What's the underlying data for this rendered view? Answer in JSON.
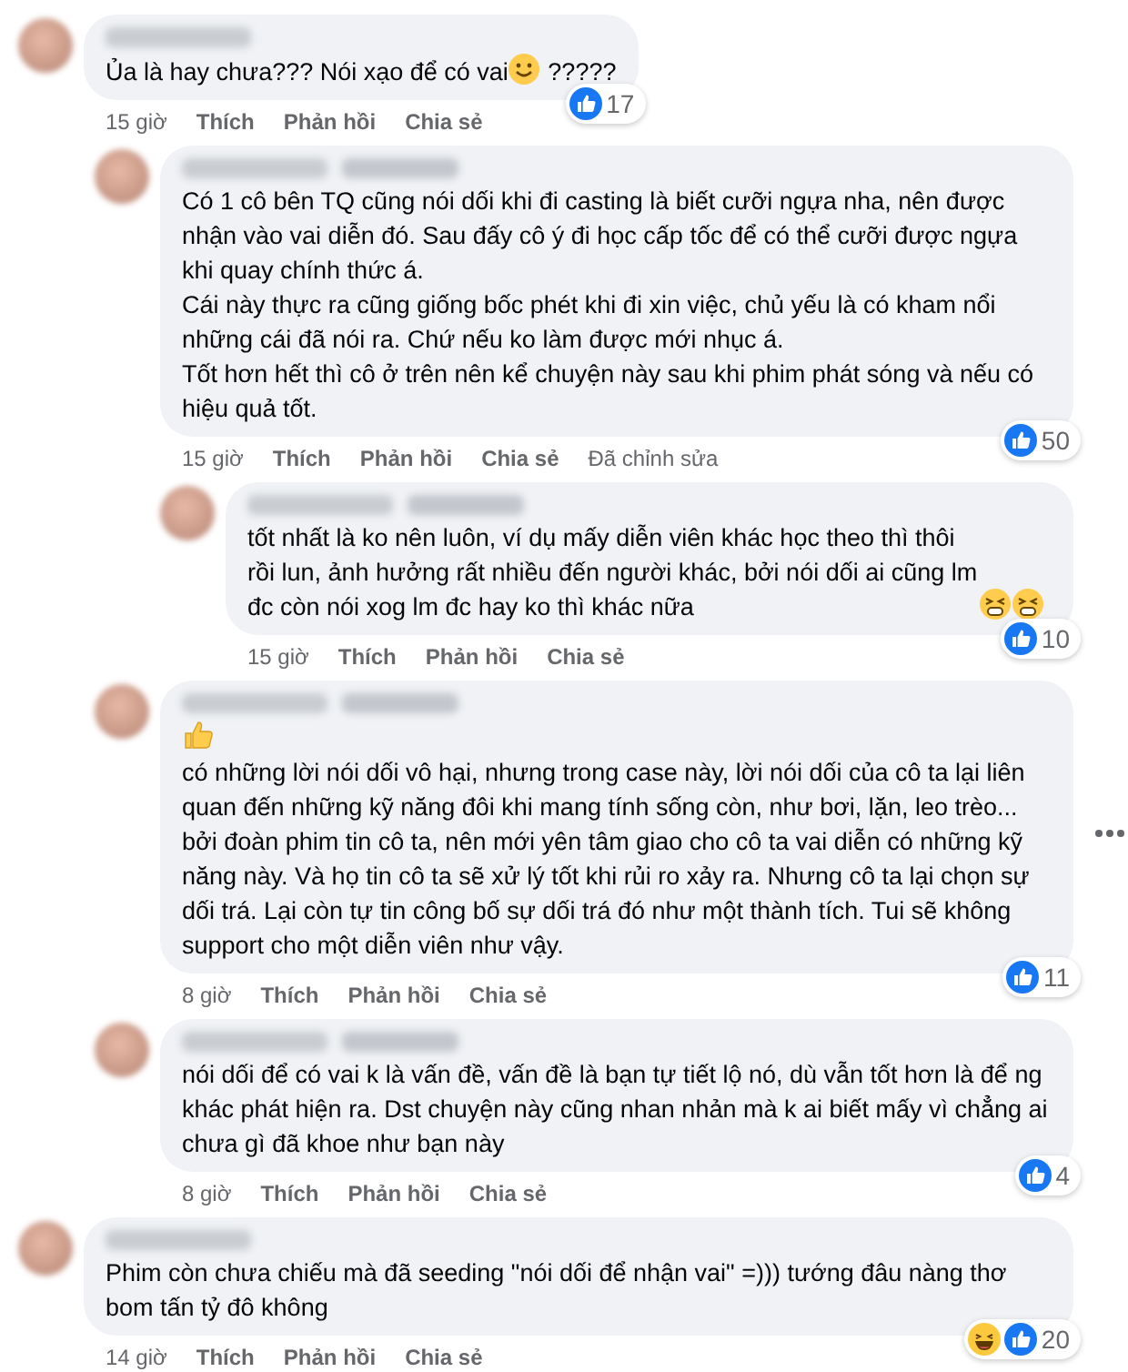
{
  "comments": [
    {
      "body": [
        {
          "kind": "text",
          "text": "Ủa là hay chưa??? Nói xạo để có vai "
        },
        {
          "kind": "smile"
        },
        {
          "kind": "text",
          "text": " ?????"
        }
      ],
      "reactions": [
        {
          "kind": "like"
        }
      ],
      "reaction_count": "17",
      "time": "15 giờ",
      "actions": [
        "Thích",
        "Phản hồi",
        "Chia sẻ"
      ],
      "children": [
        {
          "body": [
            {
              "kind": "mention"
            },
            {
              "kind": "text",
              "text": "Có 1 cô bên TQ cũng nói dối khi đi casting là biết cưỡi ngựa nha, nên được nhận vào vai diễn đó. Sau đấy cô ý đi học cấp tốc để có thể cưỡi được ngựa khi quay chính thức á.\nCái này thực ra cũng giống bốc phét khi đi xin việc, chủ yếu là có kham nổi những cái đã nói ra. Chứ nếu ko làm được mới nhục á.\nTốt hơn hết thì cô ở trên nên kể chuyện này sau khi phim phát sóng và nếu có hiệu quả tốt."
            }
          ],
          "reactions": [
            {
              "kind": "like"
            }
          ],
          "reaction_count": "50",
          "time": "15 giờ",
          "actions": [
            "Thích",
            "Phản hồi",
            "Chia sẻ"
          ],
          "edited": "Đã chỉnh sửa",
          "children": [
            {
              "body": [
                {
                  "kind": "mention"
                },
                {
                  "kind": "text",
                  "text": "tốt nhất là ko nên luôn, ví dụ mấy diễn viên khác học theo thì thôi rồi lun, ảnh hưởng rất nhiều đến người khác, bởi nói dối ai cũng lm đc còn nói xog lm đc hay ko thì khác nữa "
                },
                {
                  "kind": "tired"
                },
                {
                  "kind": "tired"
                }
              ],
              "reactions": [
                {
                  "kind": "like"
                }
              ],
              "reaction_count": "10",
              "time": "15 giờ",
              "actions": [
                "Thích",
                "Phản hồi",
                "Chia sẻ"
              ]
            }
          ]
        },
        {
          "body": [
            {
              "kind": "mention"
            },
            {
              "kind": "thumb"
            },
            {
              "kind": "break"
            },
            {
              "kind": "text",
              "text": "có những lời nói dối vô hại, nhưng trong case này, lời nói dối của cô ta lại liên quan đến những kỹ năng đôi khi mang tính sống còn, như bơi, lặn, leo trèo... bởi đoàn phim tin cô ta, nên mới yên tâm giao cho cô ta vai diễn có những kỹ năng này. Và họ tin cô ta sẽ xử lý tốt khi rủi ro xảy ra. Nhưng cô ta lại chọn sự dối trá. Lại còn tự tin công bố sự dối trá đó như một thành tích. Tui sẽ không support cho một diễn viên như vậy."
            }
          ],
          "reactions": [
            {
              "kind": "like"
            }
          ],
          "reaction_count": "11",
          "time": "8 giờ",
          "actions": [
            "Thích",
            "Phản hồi",
            "Chia sẻ"
          ],
          "more_menu": true
        },
        {
          "body": [
            {
              "kind": "mention"
            },
            {
              "kind": "text",
              "text": "nói dối để có vai k là vấn đề, vấn đề là bạn tự tiết lộ nó, dù vẫn tốt hơn là để ng khác phát hiện ra. Dst chuyện này cũng nhan nhản mà k ai biết mấy vì chẳng ai chưa gì đã khoe như bạn này"
            }
          ],
          "reactions": [
            {
              "kind": "like"
            }
          ],
          "reaction_count": "4",
          "time": "8 giờ",
          "actions": [
            "Thích",
            "Phản hồi",
            "Chia sẻ"
          ]
        }
      ]
    },
    {
      "body": [
        {
          "kind": "text",
          "text": "Phim còn chưa chiếu mà đã seeding \"nói dối để nhận vai\" =))) tướng đâu nàng thơ bom tấn tỷ đô không"
        }
      ],
      "reactions": [
        {
          "kind": "haha"
        },
        {
          "kind": "like"
        }
      ],
      "reaction_count": "20",
      "time": "14 giờ",
      "actions": [
        "Thích",
        "Phản hồi",
        "Chia sẻ"
      ]
    }
  ]
}
